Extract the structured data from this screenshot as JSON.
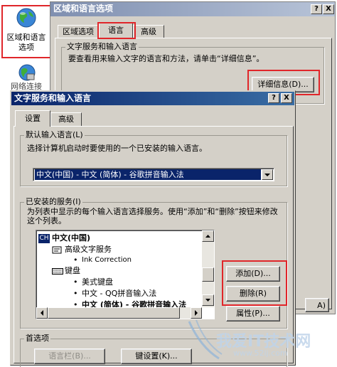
{
  "desktop": {
    "regional_icon_label": "区域和语言选项",
    "network_icon_label": "网络连接"
  },
  "regional_dialog": {
    "title": "区域和语言选项",
    "help_btn": "?",
    "close_btn": "X",
    "tabs": [
      "区域选项",
      "语言",
      "高级"
    ],
    "group_label": "文字服务和输入语言",
    "group_desc": "要查看用来输入文字的语言和方法，请单击“详细信息”。",
    "details_btn": "详细信息(D)...",
    "bottom_btn": "A)"
  },
  "text_services_dialog": {
    "title": "文字服务和输入语言",
    "help_btn": "?",
    "close_btn": "X",
    "tabs": [
      "设置",
      "高级"
    ],
    "default_group_label": "默认输入语言(L)",
    "default_group_desc": "选择计算机启动时要使用的一个已安装的输入语言。",
    "default_select_value": "中文(中国) - 中文 (简体) - 谷歌拼音输入法",
    "installed_group_label": "已安装的服务(I)",
    "installed_group_desc": "为列表中显示的每个输入语言选择服务。使用“添加”和“删除”按钮来修改这个列表。",
    "tree": {
      "lang_badge": "CH",
      "lang": "中文(中国)",
      "advanced_service": "高级文字服务",
      "ink": "Ink Correction",
      "keyboard": "键盘",
      "us_keyboard": "美式键盘",
      "qq": "中文 - QQ拼音输入法",
      "google": "中文 (简体) - 谷歌拼音输入法"
    },
    "add_btn": "添加(D)...",
    "remove_btn": "删除(R)",
    "properties_btn": "属性(P)...",
    "prefs_group_label": "首选项",
    "langbar_btn": "语言栏(B)...",
    "keyset_btn": "键设置(K)..."
  },
  "watermark": {
    "brand": "我爱IT技术网",
    "url": "www.52ij.com"
  },
  "colors": {
    "titlebar": "#0a246a",
    "dialog_face": "#d4d0c8",
    "highlight_red": "#e0262a"
  }
}
